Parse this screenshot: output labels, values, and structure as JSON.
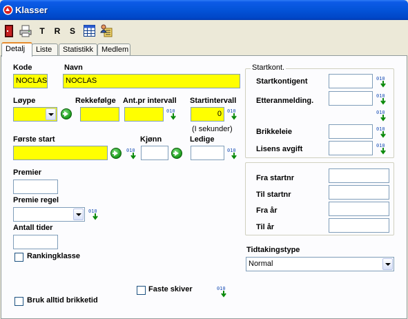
{
  "window": {
    "title": "Klasser"
  },
  "toolbar": {
    "t_label": "T",
    "r_label": "R",
    "s_label": "S"
  },
  "tabs": [
    {
      "label": "Detalj"
    },
    {
      "label": "Liste"
    },
    {
      "label": "Statistikk"
    },
    {
      "label": "Medlem"
    }
  ],
  "form": {
    "kode_label": "Kode",
    "kode_value": "NOCLAS",
    "navn_label": "Navn",
    "navn_value": "NOCLAS",
    "loype_label": "Løype",
    "loype_value": "",
    "rekkefolge_label": "Rekkefølge",
    "rekkefolge_value": "",
    "antpr_label": "Ant.pr intervall",
    "antpr_value": "",
    "startintervall_label": "Startintervall",
    "startintervall_value": "0",
    "sekunder_label": "(I sekunder)",
    "forste_start_label": "Første start",
    "forste_start_value": "",
    "kjonn_label": "Kjønn",
    "kjonn_value": "",
    "ledige_label": "Ledige",
    "ledige_value": "",
    "premier_label": "Premier",
    "premier_value": "",
    "premie_regel_label": "Premie regel",
    "premie_regel_value": "",
    "antall_tider_label": "Antall tider",
    "antall_tider_value": "",
    "rankingklasse_label": "Rankingklasse",
    "faste_skiver_label": "Faste skiver",
    "bruk_brikketid_label": "Bruk alltid brikketid"
  },
  "startkont": {
    "group_title": "Startkont.",
    "startkontigent_label": "Startkontigent",
    "etteranmelding_label": "Etteranmelding.",
    "brikkeleie_label": "Brikkeleie",
    "lisens_label": "Lisens avgift"
  },
  "range": {
    "fra_startnr_label": "Fra startnr",
    "til_startnr_label": "Til startnr",
    "fra_ar_label": "Fra år",
    "til_ar_label": "Til år"
  },
  "tidtaking": {
    "label": "Tidtakingstype",
    "value": "Normal"
  },
  "colors": {
    "required_field": "#ffff00",
    "titlebar": "#0353d8",
    "go_button": "#1a9a1a"
  },
  "icons": {
    "go": "green-arrow-icon",
    "binary": "binary-arrow-icon"
  }
}
